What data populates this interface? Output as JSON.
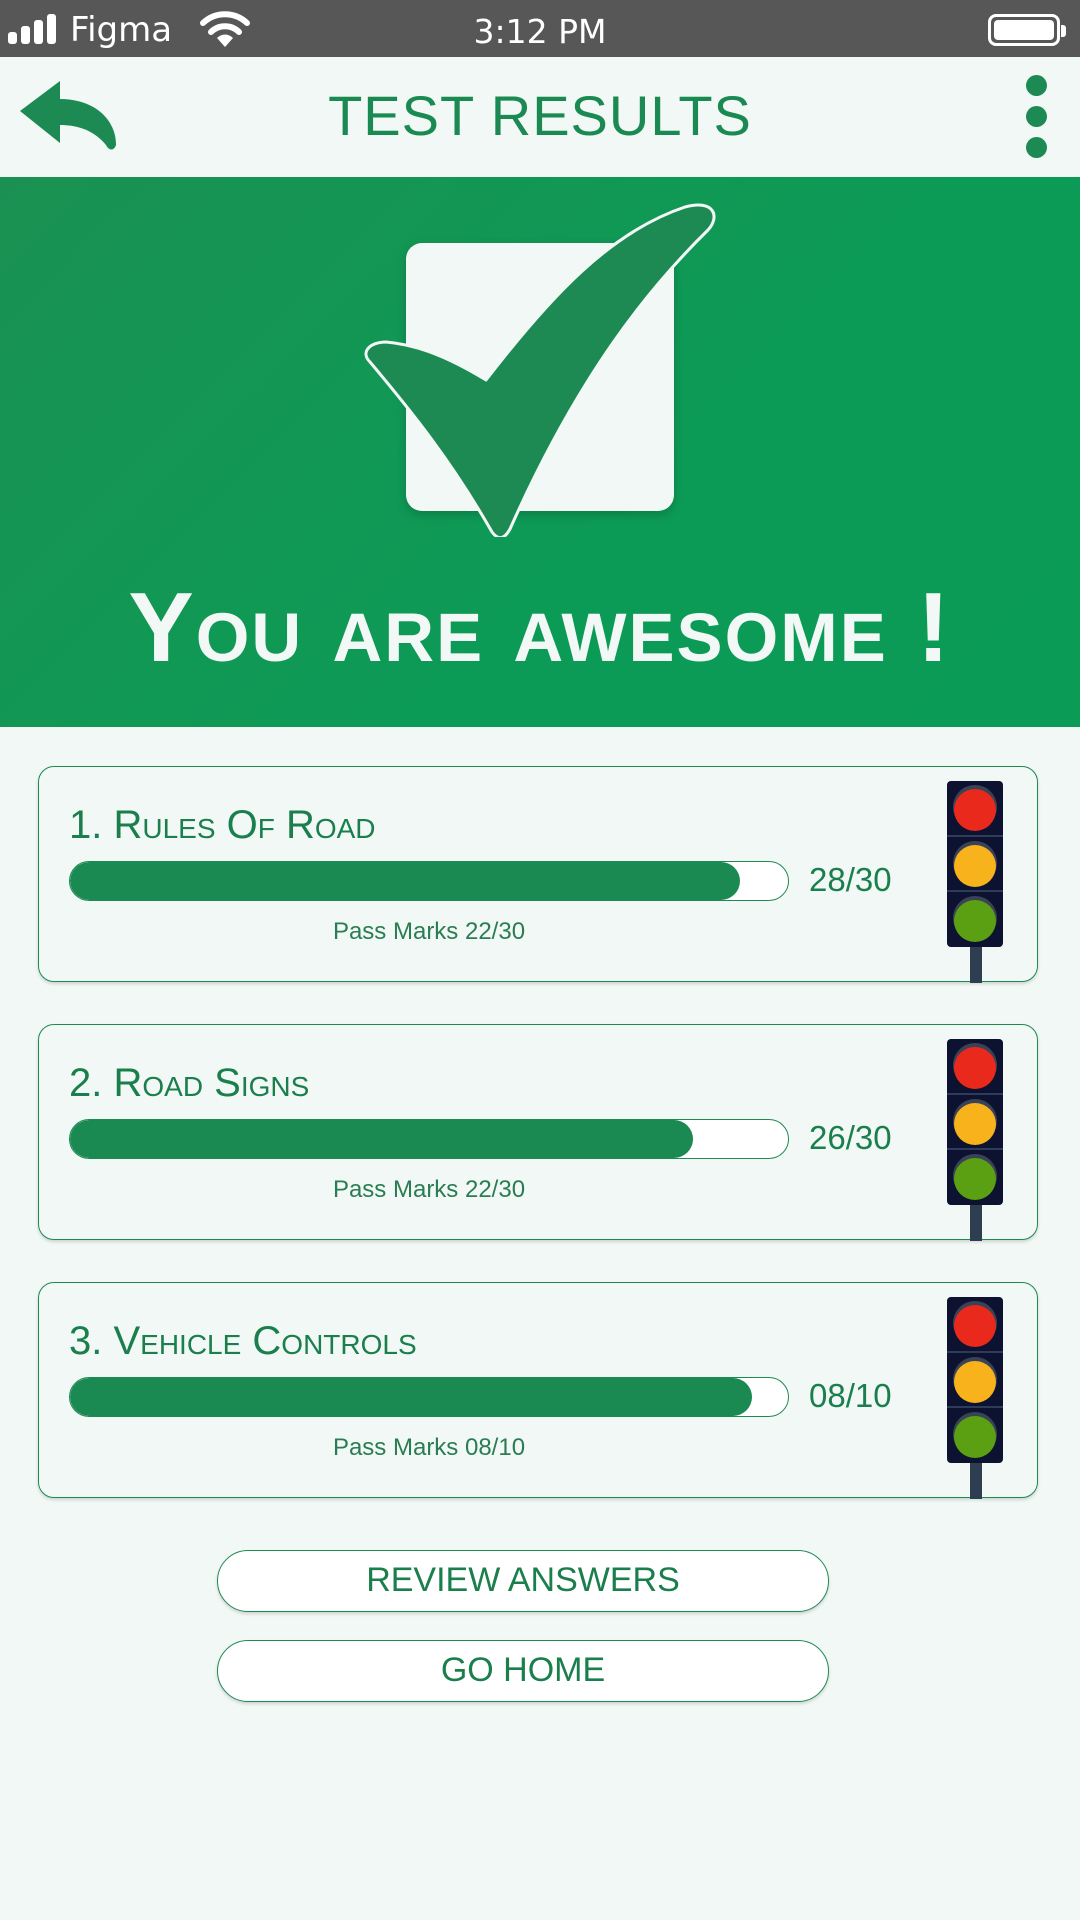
{
  "status_bar": {
    "carrier": "Figma",
    "time": "3:12 PM",
    "icons": [
      "signal-icon",
      "wifi-icon",
      "battery-icon"
    ]
  },
  "header": {
    "title": "TEST RESULTS",
    "back_icon": "back-arrow-icon",
    "menu_icon": "more-vertical-icon"
  },
  "hero": {
    "message": "You are awesome !",
    "icon": "checkmark-icon"
  },
  "results": [
    {
      "title": "1. Rules Of Road",
      "score": "28/30",
      "pass_marks": "Pass Marks 22/30",
      "progress": 0.933
    },
    {
      "title": "2. Road Signs",
      "score": "26/30",
      "pass_marks": "Pass Marks 22/30",
      "progress": 0.867
    },
    {
      "title": "3. Vehicle Controls",
      "score": "08/10",
      "pass_marks": "Pass Marks 08/10",
      "progress": 0.95
    }
  ],
  "buttons": {
    "review": "REVIEW ANSWERS",
    "home": "GO HOME"
  },
  "colors": {
    "primary": "#1a8a52",
    "hero_bg": "#0c9b56",
    "background": "#f1f8f5",
    "status_bar": "#575757",
    "light_red": "#e8291c",
    "light_amber": "#f7b21c",
    "light_green": "#5aa012"
  }
}
